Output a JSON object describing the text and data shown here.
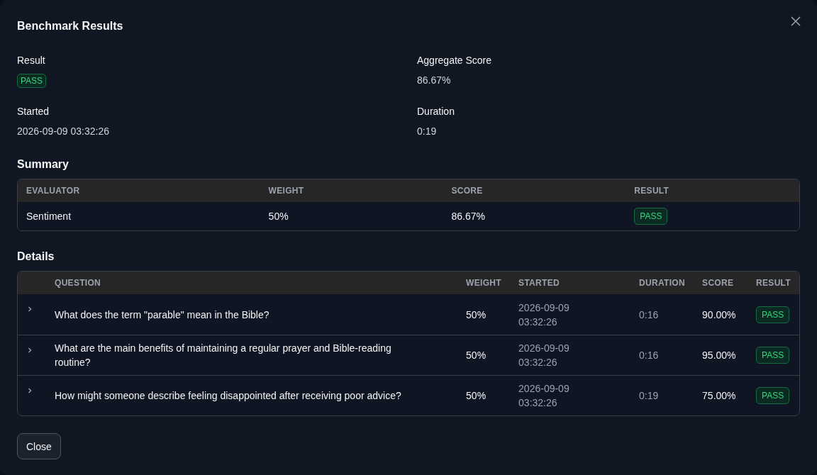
{
  "dialog": {
    "title": "Benchmark Results",
    "fields": [
      {
        "label": "Result",
        "badge": {
          "text": "PASS",
          "kind": "pass"
        }
      },
      {
        "label": "Aggregate Score",
        "value": "86.67%"
      },
      {
        "label": "Started",
        "value": "2026-09-09 03:32:26"
      },
      {
        "label": "Duration",
        "value": "0:19"
      }
    ],
    "summary": {
      "title": "Summary",
      "columns": [
        "EVALUATOR",
        "WEIGHT",
        "SCORE",
        "RESULT"
      ],
      "rows": [
        {
          "evaluator": "Sentiment",
          "weight": "50%",
          "score": "86.67%",
          "result": {
            "text": "PASS",
            "kind": "pass"
          }
        }
      ]
    },
    "details": {
      "title": "Details",
      "columns": [
        "QUESTION",
        "WEIGHT",
        "STARTED",
        "DURATION",
        "SCORE",
        "RESULT"
      ],
      "rows": [
        {
          "expanded": false,
          "question": "What does the term \"parable\" mean in the Bible?",
          "weight": "50%",
          "started": "2026-09-09 03:32:26",
          "duration": "0:16",
          "score": "90.00%",
          "result": {
            "text": "PASS",
            "kind": "pass"
          }
        },
        {
          "expanded": false,
          "question": "What are the main benefits of maintaining a regular prayer and Bible-reading routine?",
          "weight": "50%",
          "started": "2026-09-09 03:32:26",
          "duration": "0:16",
          "score": "95.00%",
          "result": {
            "text": "PASS",
            "kind": "pass"
          }
        },
        {
          "expanded": false,
          "question": "How might someone describe feeling disappointed after receiving poor advice?",
          "weight": "50%",
          "started": "2026-09-09 03:32:26",
          "duration": "0:19",
          "score": "75.00%",
          "result": {
            "text": "PASS",
            "kind": "pass"
          }
        }
      ]
    },
    "buttons": [
      "Close"
    ]
  }
}
